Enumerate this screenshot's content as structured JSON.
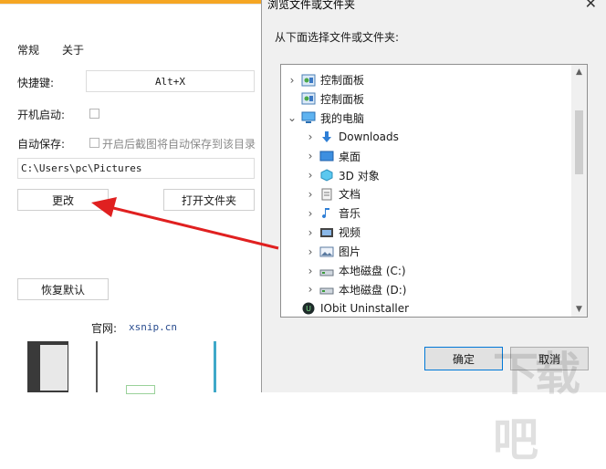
{
  "settings": {
    "tabs": [
      "常规",
      "关于"
    ],
    "shortcut_label": "快捷键:",
    "shortcut_value": "Alt+X",
    "startup_label": "开机启动:",
    "autosave_label": "自动保存:",
    "autosave_option": "开启后截图将自动保存到该目录",
    "path_value": "C:\\Users\\pc\\Pictures",
    "change_button": "更改",
    "open_folder_button": "打开文件夹",
    "restore_button": "恢复默认",
    "website_label": "官网:",
    "website_value": "xsnip.cn",
    "accent_color": "#f5a623"
  },
  "dialog": {
    "title": "浏览文件或文件夹",
    "prompt": "从下面选择文件或文件夹:",
    "tree": [
      {
        "label": "控制面板",
        "icon": "control-panel-icon",
        "chevron": ">",
        "indent": 0
      },
      {
        "label": "控制面板",
        "icon": "control-panel-icon",
        "chevron": "",
        "indent": 0
      },
      {
        "label": "我的电脑",
        "icon": "computer-icon",
        "chevron": "v",
        "indent": 0
      },
      {
        "label": "Downloads",
        "icon": "download-icon",
        "chevron": ">",
        "indent": 1
      },
      {
        "label": "桌面",
        "icon": "desktop-icon",
        "chevron": ">",
        "indent": 1
      },
      {
        "label": "3D 对象",
        "icon": "3d-objects-icon",
        "chevron": ">",
        "indent": 1
      },
      {
        "label": "文档",
        "icon": "document-icon",
        "chevron": ">",
        "indent": 1
      },
      {
        "label": "音乐",
        "icon": "music-icon",
        "chevron": ">",
        "indent": 1
      },
      {
        "label": "视频",
        "icon": "video-icon",
        "chevron": ">",
        "indent": 1
      },
      {
        "label": "图片",
        "icon": "picture-icon",
        "chevron": ">",
        "indent": 1
      },
      {
        "label": "本地磁盘 (C:)",
        "icon": "drive-icon",
        "chevron": ">",
        "indent": 1
      },
      {
        "label": "本地磁盘 (D:)",
        "icon": "drive-icon",
        "chevron": ">",
        "indent": 1
      },
      {
        "label": "IObit Uninstaller",
        "icon": "iobit-icon",
        "chevron": "",
        "indent": 0
      }
    ],
    "ok_button": "确定",
    "cancel_button": "取消",
    "close_glyph": "✕"
  },
  "watermark": "下载吧"
}
